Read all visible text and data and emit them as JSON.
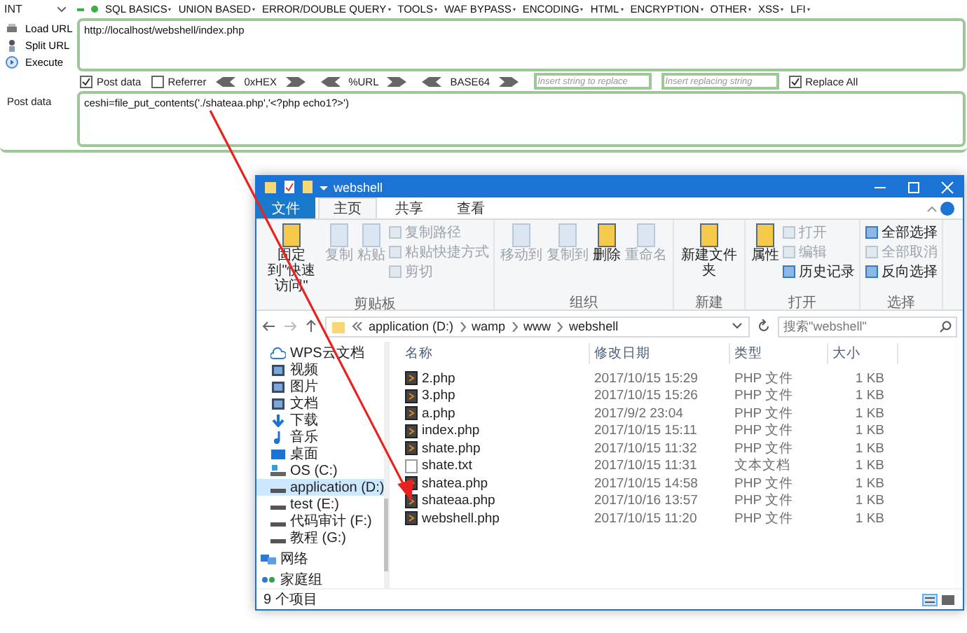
{
  "toolbar": {
    "select": "INT",
    "menus": [
      "SQL BASICS",
      "UNION BASED",
      "ERROR/DOUBLE QUERY",
      "TOOLS",
      "WAF BYPASS",
      "ENCODING",
      "HTML",
      "ENCRYPTION",
      "OTHER",
      "XSS",
      "LFI"
    ]
  },
  "actions": [
    {
      "label": "Load URL",
      "kind": "load"
    },
    {
      "label": "Split URL",
      "kind": "split"
    },
    {
      "label": "Execute",
      "kind": "execute"
    }
  ],
  "url_field": {
    "value": "http://localhost/webshell/index.php"
  },
  "checks": [
    {
      "label": "Post data",
      "checked": true
    },
    {
      "label": "Referrer",
      "checked": false
    }
  ],
  "encoders": [
    "0xHEX",
    "%URL",
    "BASE64"
  ],
  "replace_fields": [
    {
      "placeholder": "Insert string to replace"
    },
    {
      "placeholder": "Insert replacing string"
    }
  ],
  "replace_all": {
    "label": "Replace All",
    "checked": true
  },
  "post": {
    "label": "Post data",
    "value": "ceshi=file_put_contents('./shateaa.php','<?php echo1?>')"
  },
  "explorer": {
    "title": "webshell",
    "tabs": [
      {
        "label": "文件",
        "selected": false,
        "kind": "file"
      },
      {
        "label": "主页",
        "selected": true,
        "kind": "tab"
      },
      {
        "label": "共享",
        "selected": false,
        "kind": "tab"
      },
      {
        "label": "查看",
        "selected": false,
        "kind": "tab"
      }
    ],
    "groups": [
      {
        "label": "剪贴板",
        "large": [
          {
            "label": "固定到\"快速访问\"",
            "disabled": false
          },
          {
            "label": "复制",
            "disabled": true
          },
          {
            "label": "粘贴",
            "disabled": true
          }
        ],
        "small": [
          {
            "label": "复制路径",
            "disabled": true
          },
          {
            "label": "粘贴快捷方式",
            "disabled": true
          },
          {
            "label": "剪切",
            "disabled": true
          }
        ]
      },
      {
        "label": "组织",
        "large": [
          {
            "label": "移动到",
            "disabled": true
          },
          {
            "label": "复制到",
            "disabled": true
          },
          {
            "label": "删除",
            "disabled": false
          },
          {
            "label": "重命名",
            "disabled": true
          }
        ]
      },
      {
        "label": "新建",
        "large": [
          {
            "label": "新建文件夹",
            "disabled": false
          }
        ]
      },
      {
        "label": "打开",
        "large": [
          {
            "label": "属性",
            "disabled": false
          }
        ],
        "small": [
          {
            "label": "打开",
            "disabled": true
          },
          {
            "label": "编辑",
            "disabled": true
          },
          {
            "label": "历史记录",
            "disabled": false
          }
        ]
      },
      {
        "label": "选择",
        "small": [
          {
            "label": "全部选择",
            "disabled": false
          },
          {
            "label": "全部取消",
            "disabled": true
          },
          {
            "label": "反向选择",
            "disabled": false
          }
        ]
      }
    ],
    "path": [
      "application (D:)",
      "wamp",
      "www",
      "webshell"
    ],
    "search": {
      "placeholder": "搜索\"webshell\""
    },
    "nav": [
      {
        "label": "WPS云文档",
        "kind": "cloud",
        "selected": false
      },
      {
        "label": "视频",
        "kind": "library",
        "selected": false
      },
      {
        "label": "图片",
        "kind": "library",
        "selected": false
      },
      {
        "label": "文档",
        "kind": "library",
        "selected": false
      },
      {
        "label": "下载",
        "kind": "download",
        "selected": false
      },
      {
        "label": "音乐",
        "kind": "music",
        "selected": false
      },
      {
        "label": "桌面",
        "kind": "desktop",
        "selected": false
      },
      {
        "label": "OS (C:)",
        "kind": "system",
        "selected": false
      },
      {
        "label": "application (D:)",
        "kind": "drive",
        "selected": true
      },
      {
        "label": "test (E:)",
        "kind": "drive",
        "selected": false
      },
      {
        "label": "代码审计 (F:)",
        "kind": "drive",
        "selected": false
      },
      {
        "label": "教程 (G:)",
        "kind": "drive",
        "selected": false
      },
      {
        "label": "网络",
        "kind": "network",
        "selected": false
      },
      {
        "label": "家庭组",
        "kind": "homegroup",
        "selected": false
      }
    ],
    "columns": [
      "名称",
      "修改日期",
      "类型",
      "大小"
    ],
    "files": [
      {
        "name": "2.php",
        "date": "2017/10/15 15:29",
        "type": "PHP 文件",
        "size": "1 KB",
        "kind": "php"
      },
      {
        "name": "3.php",
        "date": "2017/10/15 15:26",
        "type": "PHP 文件",
        "size": "1 KB",
        "kind": "php"
      },
      {
        "name": "a.php",
        "date": "2017/9/2 23:04",
        "type": "PHP 文件",
        "size": "1 KB",
        "kind": "php"
      },
      {
        "name": "index.php",
        "date": "2017/10/15 15:11",
        "type": "PHP 文件",
        "size": "1 KB",
        "kind": "php"
      },
      {
        "name": "shate.php",
        "date": "2017/10/15 11:32",
        "type": "PHP 文件",
        "size": "1 KB",
        "kind": "php"
      },
      {
        "name": "shate.txt",
        "date": "2017/10/15 11:31",
        "type": "文本文档",
        "size": "1 KB",
        "kind": "txt"
      },
      {
        "name": "shatea.php",
        "date": "2017/10/15 14:58",
        "type": "PHP 文件",
        "size": "1 KB",
        "kind": "php"
      },
      {
        "name": "shateaa.php",
        "date": "2017/10/16 13:57",
        "type": "PHP 文件",
        "size": "1 KB",
        "kind": "php"
      },
      {
        "name": "webshell.php",
        "date": "2017/10/15 11:20",
        "type": "PHP 文件",
        "size": "1 KB",
        "kind": "php"
      }
    ],
    "status": "9 个项目"
  }
}
